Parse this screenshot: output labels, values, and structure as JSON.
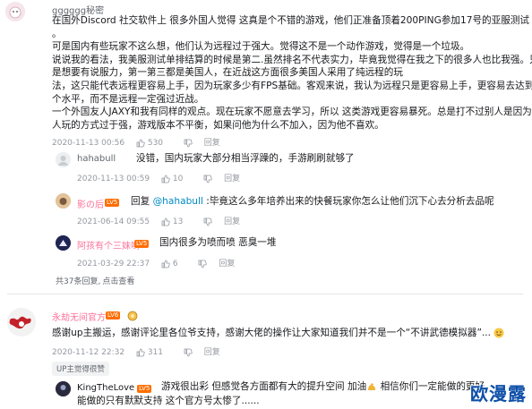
{
  "comments": [
    {
      "username": "gggggg秘密",
      "lines": [
        "在国外Discord 社交软件上  很多外国人觉得 这真是个不错的游戏，他们正准备顶着200PING参加17号的亚服测试",
        "。",
        "可是国内有些玩家不这么想，他们认为远程过于强大。觉得这不是一个动作游戏，觉得是一个垃圾。",
        "说说我的看法，我美服测试单排结算的时候是第二.虽然排名不代表实力，毕竟我觉得在我之下的很多人也比我强。只",
        "是想要有说服力，第一第三都是美国人，在近战这方面很多美国人采用了纯远程的玩",
        "法，这只能代表远程更容易上手，因为玩家多少有FPS基础。客观来说，我认为远程只是更容易上手，更容易去达到一",
        "个水平，而不是远程一定强过近战。",
        "一个外国友人JAXY和我有同样的观点。现在玩家不愿意去学习，所以 这类游戏更容易暴死。总是打不过别人是因为别",
        "人玩的方式过于强，游戏版本不平衡，如果问他为什么不加入，因为他不喜欢。"
      ],
      "date": "2020-11-13 00:56",
      "likes": "530"
    },
    {
      "username": "hahabull",
      "text": "没错，国内玩家大部分相当浮躁的，手游刷刷就够了",
      "date": "2020-11-13 00:59",
      "likes": "10"
    },
    {
      "username": "影の后",
      "level": "LV5",
      "reply_prefix": "回复 ",
      "mention": "@hahabull",
      "text": " :毕竟这么多年培养出来的快餐玩家你怎么让他们沉下心去分析去品呢",
      "date": "2021-06-14 09:55",
      "likes": "13"
    },
    {
      "username": "阿孩有个三妹哟",
      "level": "LV5",
      "text": "国内很多为喷而喷  恶臭一堆",
      "date": "2021-03-29 22:37",
      "likes": "6"
    },
    {
      "username": "永劫无间官方",
      "level": "LV6",
      "text": "感谢up主搬运，感谢评论里各位爷支持，感谢大佬的操作让大家知道我们并不是一个“不讲武德模拟器”...",
      "date": "2020-11-12 22:32",
      "likes": "311"
    },
    {
      "username": "KingTheLove",
      "level": "LV5",
      "text_line1_a": "游戏很出彩 但感觉各方面都有大的提升空间 加油",
      "text_line1_b": " 相信你们一定能做的更好，",
      "text_line2": "能做的只有默默支持 这个官方号太惨了......"
    }
  ],
  "reply_count_text": "共37条回复,",
  "reply_view_link": "点击查看",
  "tag_text": "UP主觉得很赞",
  "action_labels": {
    "reply": "回复"
  },
  "watermark": "欧漫露",
  "colors": {
    "mention": "#008ac5",
    "username_pink": "#fb7299",
    "level_orange": "#ff6d00"
  }
}
